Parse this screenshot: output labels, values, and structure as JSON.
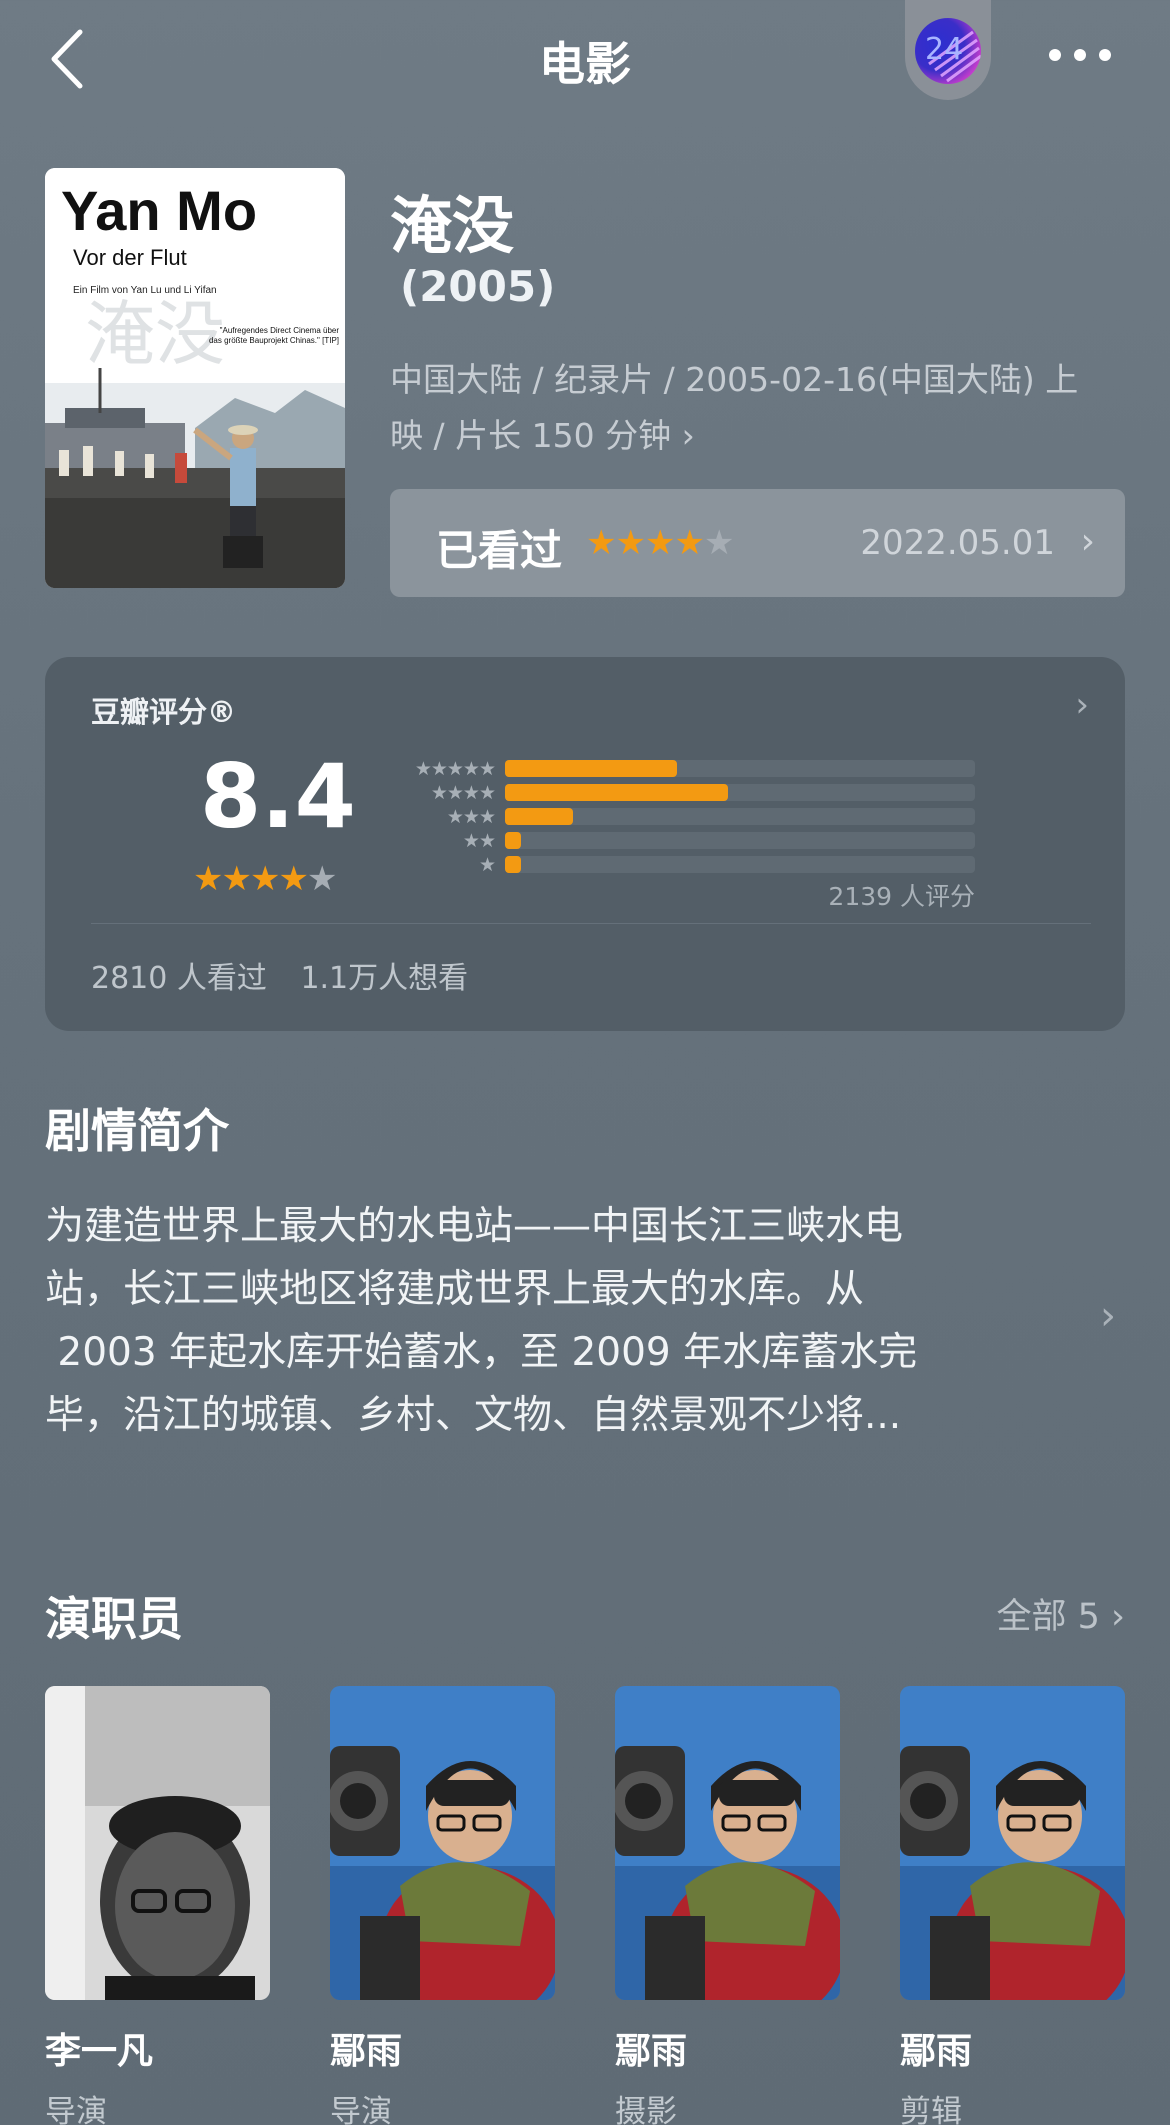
{
  "header": {
    "title": "电影",
    "badge_text": "24"
  },
  "movie": {
    "title": "淹没",
    "year": "(2005)",
    "meta_line1": "中国大陆 / 纪录片 / 2005-02-16(中国大陆) 上",
    "meta_line2": "映 / 片长 150 分钟",
    "poster": {
      "title": "Yan Mo",
      "subtitle": "Vor der Flut",
      "credit": "Ein Film von Yan Lu und Li Yifan",
      "chinese_title": "淹没",
      "quote": "\"Aufregendes Direct Cinema über das größte Bauprojekt Chinas.\"",
      "quote_source": "[TIP]"
    }
  },
  "watched": {
    "label": "已看过",
    "stars": 4,
    "date": "2022.05.01"
  },
  "rating": {
    "source": "豆瓣评分®",
    "score": "8.4",
    "stars": 4,
    "distribution": [
      {
        "stars": "★★★★★",
        "fraction": 0.365
      },
      {
        "stars": "★★★★",
        "fraction": 0.475
      },
      {
        "stars": "★★★",
        "fraction": 0.145
      },
      {
        "stars": "★★",
        "fraction": 0.035
      },
      {
        "stars": "★",
        "fraction": 0.035
      }
    ],
    "count": "2139 人评分",
    "watched_count": "2810 人看过",
    "want_count": "1.1万人想看"
  },
  "synopsis": {
    "title": "剧情简介",
    "lines": [
      "为建造世界上最大的水电站——中国长江三峡水电",
      "站，长江三峡地区将建成世界上最大的水库。从",
      " 2003 年起水库开始蓄水，至 2009 年水库蓄水完",
      "毕，沿江的城镇、乡村、文物、自然景观不少将..."
    ]
  },
  "cast": {
    "title": "演职员",
    "all_label": "全部 5",
    "members": [
      {
        "name": "李一凡",
        "role": "导演",
        "photo": "bw-portrait"
      },
      {
        "name": "鄢雨",
        "role": "导演",
        "photo": "cameraman"
      },
      {
        "name": "鄢雨",
        "role": "摄影",
        "photo": "cameraman"
      },
      {
        "name": "鄢雨",
        "role": "剪辑",
        "photo": "cameraman"
      }
    ]
  },
  "colors": {
    "accent_star": "#f39a12",
    "background": "#6f7b85",
    "card": "#535e67"
  }
}
